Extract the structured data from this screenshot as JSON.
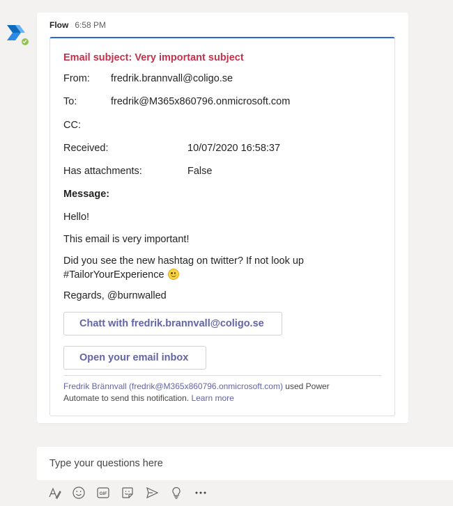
{
  "message": {
    "sender": "Flow",
    "time": "6:58 PM"
  },
  "card": {
    "subject_label": "Email subject:",
    "subject": "Very important subject",
    "from_label": "From:",
    "from_value": "fredrik.brannvall@coligo.se",
    "to_label": "To:",
    "to_value": "fredrik@M365x860796.onmicrosoft.com",
    "cc_label": "CC:",
    "received_label": "Received:",
    "received_value": "10/07/2020 16:58:37",
    "attachments_label": "Has attachments:",
    "attachments_value": "False",
    "message_label": "Message:",
    "body_line1": "Hello!",
    "body_line2": "This email is very important!",
    "body_line3a": "Did you see the new hashtag on twitter? If not look up",
    "body_line3b": "#TailorYourExperience",
    "body_line4": "Regards, @burnwalled",
    "chat_button": "Chatt with fredrik.brannvall@coligo.se",
    "inbox_button": "Open your email inbox",
    "footer_user": "Fredrik Brännvall (fredrik@M365x860796.onmicrosoft.com)",
    "footer_text": " used Power Automate to send this notification. ",
    "footer_link": "Learn more"
  },
  "compose": {
    "placeholder": "Type your questions here"
  },
  "toolbar": {
    "icons": [
      "format-icon",
      "emoji-icon",
      "gif-icon",
      "sticker-icon",
      "send-icon",
      "praise-icon",
      "more-options-icon"
    ]
  },
  "colors": {
    "subject": "#c4314b",
    "accent": "#6264a7",
    "card_top_border": "#2b65d9",
    "background": "#f3f2f1"
  }
}
